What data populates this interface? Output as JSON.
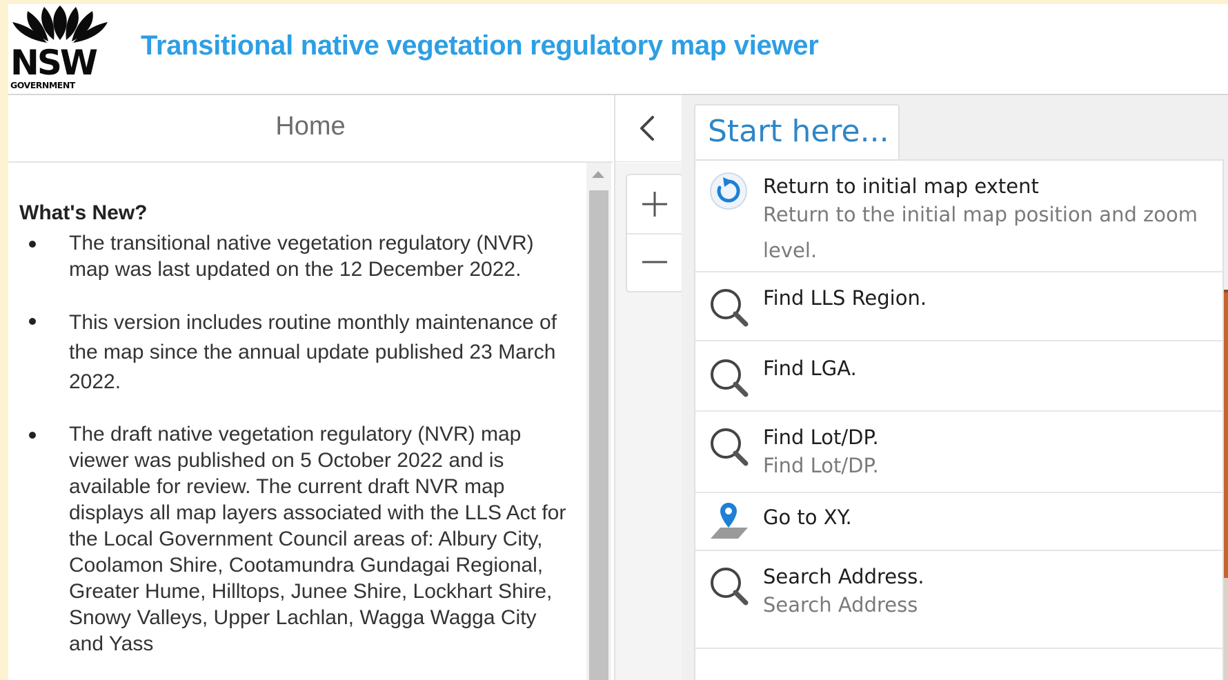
{
  "header": {
    "title": "Transitional native vegetation regulatory map viewer",
    "logo": {
      "wordmark": "NSW",
      "subtext": "GOVERNMENT"
    }
  },
  "left_panel": {
    "tab_label": "Home",
    "heading": "What's New?",
    "bullets": [
      "The transitional native vegetation regulatory (NVR) map was last updated on the 12 December 2022.",
      "This version includes routine monthly maintenance of the map since the annual update published 23 March 2022.",
      "The draft native vegetation regulatory (NVR) map viewer was published on 5 October 2022 and is available for review. The current draft NVR map displays all map layers associated with the LLS Act for the Local Government Council areas of: Albury City, Coolamon Shire, Cootamundra Gundagai Regional, Greater Hume, Hilltops, Junee Shire, Lockhart Shire, Snowy Valleys, Upper Lachlan, Wagga Wagga City and Yass"
    ]
  },
  "controls": {
    "collapse_icon": "chevron-left-icon",
    "zoom_in_icon": "plus-icon",
    "zoom_out_icon": "minus-icon"
  },
  "start_panel": {
    "tab_label": "Start here...",
    "items": [
      {
        "icon": "refresh-icon",
        "title": "Return to initial map extent",
        "description": "Return to the initial map position and zoom level."
      },
      {
        "icon": "search-icon",
        "title": "Find LLS Region.",
        "description": ""
      },
      {
        "icon": "search-icon",
        "title": "Find LGA.",
        "description": ""
      },
      {
        "icon": "search-icon",
        "title": "Find Lot/DP.",
        "description": "Find Lot/DP."
      },
      {
        "icon": "map-pin-icon",
        "title": "Go to XY.",
        "description": ""
      },
      {
        "icon": "search-icon",
        "title": "Search Address.",
        "description": "Search Address"
      }
    ]
  },
  "colors": {
    "title_blue": "#2d9fe4",
    "tab_blue": "#2e86c8",
    "page_background": "#fdf3d2"
  }
}
